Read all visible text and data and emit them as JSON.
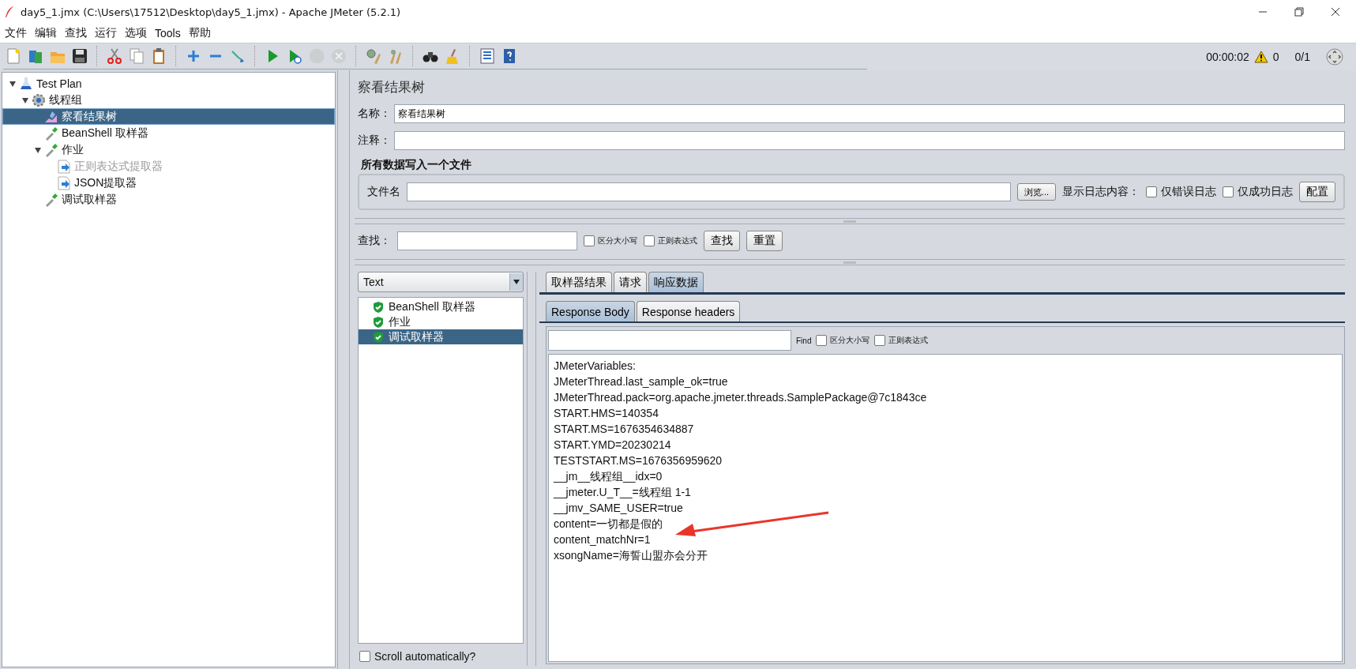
{
  "window": {
    "title": "day5_1.jmx (C:\\Users\\17512\\Desktop\\day5_1.jmx) - Apache JMeter (5.2.1)"
  },
  "menu": [
    "文件",
    "编辑",
    "查找",
    "运行",
    "选项",
    "Tools",
    "帮助"
  ],
  "toolbar": [
    [
      {
        "kind": "new",
        "disabled": false
      },
      {
        "kind": "templates",
        "disabled": false
      },
      {
        "kind": "open",
        "disabled": false
      },
      {
        "kind": "save",
        "disabled": false
      }
    ],
    [
      {
        "kind": "cut",
        "disabled": false
      },
      {
        "kind": "copy",
        "disabled": false
      },
      {
        "kind": "paste",
        "disabled": false
      }
    ],
    [
      {
        "kind": "expand",
        "disabled": false
      },
      {
        "kind": "collapse",
        "disabled": false
      },
      {
        "kind": "toggle",
        "disabled": false
      }
    ],
    [
      {
        "kind": "start",
        "disabled": false
      },
      {
        "kind": "start-no-pauses",
        "disabled": false
      },
      {
        "kind": "stop",
        "disabled": true
      },
      {
        "kind": "shutdown",
        "disabled": true
      }
    ],
    [
      {
        "kind": "clear",
        "disabled": false
      },
      {
        "kind": "clear-all",
        "disabled": false
      }
    ],
    [
      {
        "kind": "search",
        "disabled": false
      },
      {
        "kind": "reset-search",
        "disabled": false
      }
    ],
    [
      {
        "kind": "function-helper",
        "disabled": false
      },
      {
        "kind": "help",
        "disabled": false
      }
    ]
  ],
  "status": {
    "elapsed": "00:00:02",
    "warnings": "0",
    "threads": "0/1"
  },
  "tree": [
    {
      "label": "Test Plan",
      "kind": "plan",
      "expanded": true,
      "selected": false,
      "disabled": false,
      "children": [
        {
          "label": "线程组",
          "kind": "thread-group",
          "expanded": true,
          "selected": false,
          "disabled": false,
          "children": [
            {
              "label": "察看结果树",
              "kind": "listener",
              "selected": true,
              "disabled": false
            },
            {
              "label": "BeanShell 取样器",
              "kind": "sampler",
              "selected": false,
              "disabled": false
            },
            {
              "label": "作业",
              "kind": "sampler",
              "expanded": true,
              "selected": false,
              "disabled": false,
              "children": [
                {
                  "label": "正则表达式提取器",
                  "kind": "extractor",
                  "selected": false,
                  "disabled": true
                },
                {
                  "label": "JSON提取器",
                  "kind": "extractor",
                  "selected": false,
                  "disabled": false
                }
              ]
            },
            {
              "label": "调试取样器",
              "kind": "sampler",
              "selected": false,
              "disabled": false
            }
          ]
        }
      ]
    }
  ],
  "panel": {
    "title": "察看结果树",
    "name_label": "名称：",
    "name_value": "察看结果树",
    "comment_label": "注释：",
    "file_section": {
      "title": "所有数据写入一个文件",
      "file_label": "文件名",
      "browse": "浏览...",
      "log_label": "显示日志内容：",
      "errors_only": {
        "label": "仅错误日志",
        "checked": false
      },
      "successes_only": {
        "label": "仅成功日志",
        "checked": false
      },
      "configure": "配置"
    }
  },
  "search": {
    "label": "查找：",
    "case_sensitive": {
      "label": "区分大小写",
      "checked": false
    },
    "regex": {
      "label": "正则表达式",
      "checked": false
    },
    "find": "查找",
    "reset": "重置"
  },
  "renderer": "Text",
  "results": [
    {
      "label": "BeanShell 取样器",
      "selected": false
    },
    {
      "label": "作业",
      "selected": false
    },
    {
      "label": "调试取样器",
      "selected": true
    }
  ],
  "scroll_auto": {
    "label": "Scroll automatically?",
    "checked": false
  },
  "tabs": [
    {
      "label": "取样器结果",
      "selected": false
    },
    {
      "label": "请求",
      "selected": false
    },
    {
      "label": "响应数据",
      "selected": true
    }
  ],
  "subtabs": [
    {
      "label": "Response Body",
      "selected": true
    },
    {
      "label": "Response headers",
      "selected": false
    }
  ],
  "body_find": {
    "label": "Find",
    "case_sensitive": {
      "label": "区分大小写",
      "checked": false
    },
    "regex": {
      "label": "正则表达式",
      "checked": false
    }
  },
  "response_lines": [
    "JMeterVariables:",
    "JMeterThread.last_sample_ok=true",
    "JMeterThread.pack=org.apache.jmeter.threads.SamplePackage@7c1843ce",
    "START.HMS=140354",
    "START.MS=1676354634887",
    "START.YMD=20230214",
    "TESTSTART.MS=1676356959620",
    "__jm__线程组__idx=0",
    "__jmeter.U_T__=线程组 1-1",
    "__jmv_SAME_USER=true",
    "content=一切都是假的",
    "content_matchNr=1",
    "xsongName=海誓山盟亦会分开"
  ]
}
